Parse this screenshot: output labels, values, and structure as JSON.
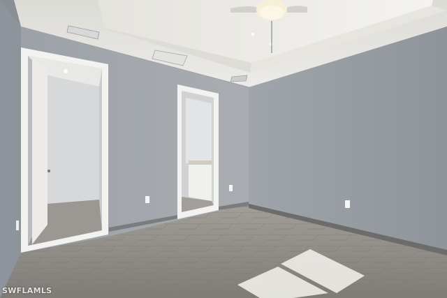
{
  "watermark": {
    "text": "SWFLAMLS"
  },
  "colors": {
    "left_wall": "#8e949b",
    "back_wall": "#a4a9ae",
    "right_wall": "#979ca3",
    "ceiling": "#e9e8e3",
    "tray_ceiling": "#f1f0ec",
    "floor": "#8d8984",
    "baseboard": "#6c6c6a",
    "door_trim": "#f2f2f0",
    "sunlight": "#eeede8"
  },
  "icons": [
    "ceiling-fan-icon",
    "recessed-light-icon",
    "air-vent-icon",
    "outlet-icon"
  ]
}
